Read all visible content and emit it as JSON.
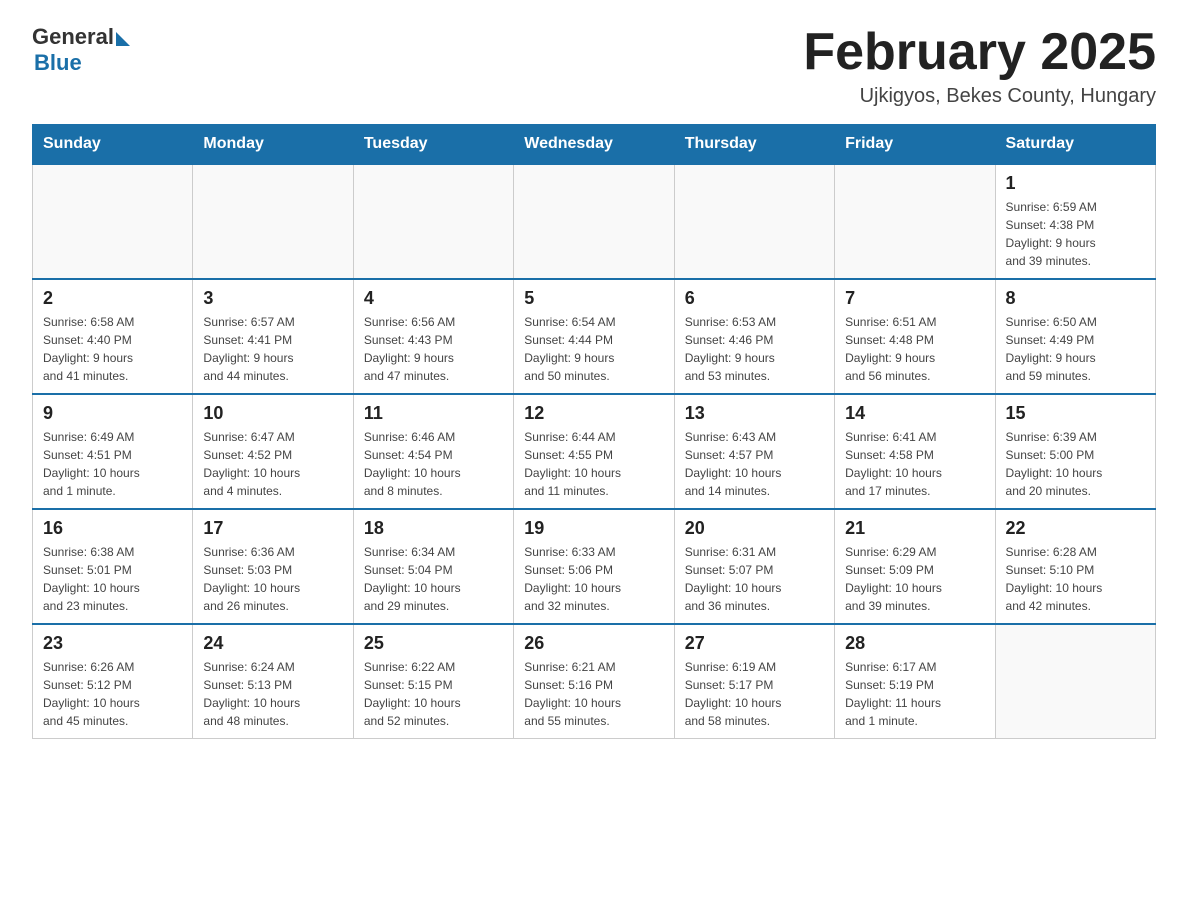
{
  "header": {
    "logo_general": "General",
    "logo_blue": "Blue",
    "month_title": "February 2025",
    "location": "Ujkigyos, Bekes County, Hungary"
  },
  "weekdays": [
    "Sunday",
    "Monday",
    "Tuesday",
    "Wednesday",
    "Thursday",
    "Friday",
    "Saturday"
  ],
  "weeks": [
    [
      {
        "day": "",
        "info": ""
      },
      {
        "day": "",
        "info": ""
      },
      {
        "day": "",
        "info": ""
      },
      {
        "day": "",
        "info": ""
      },
      {
        "day": "",
        "info": ""
      },
      {
        "day": "",
        "info": ""
      },
      {
        "day": "1",
        "info": "Sunrise: 6:59 AM\nSunset: 4:38 PM\nDaylight: 9 hours\nand 39 minutes."
      }
    ],
    [
      {
        "day": "2",
        "info": "Sunrise: 6:58 AM\nSunset: 4:40 PM\nDaylight: 9 hours\nand 41 minutes."
      },
      {
        "day": "3",
        "info": "Sunrise: 6:57 AM\nSunset: 4:41 PM\nDaylight: 9 hours\nand 44 minutes."
      },
      {
        "day": "4",
        "info": "Sunrise: 6:56 AM\nSunset: 4:43 PM\nDaylight: 9 hours\nand 47 minutes."
      },
      {
        "day": "5",
        "info": "Sunrise: 6:54 AM\nSunset: 4:44 PM\nDaylight: 9 hours\nand 50 minutes."
      },
      {
        "day": "6",
        "info": "Sunrise: 6:53 AM\nSunset: 4:46 PM\nDaylight: 9 hours\nand 53 minutes."
      },
      {
        "day": "7",
        "info": "Sunrise: 6:51 AM\nSunset: 4:48 PM\nDaylight: 9 hours\nand 56 minutes."
      },
      {
        "day": "8",
        "info": "Sunrise: 6:50 AM\nSunset: 4:49 PM\nDaylight: 9 hours\nand 59 minutes."
      }
    ],
    [
      {
        "day": "9",
        "info": "Sunrise: 6:49 AM\nSunset: 4:51 PM\nDaylight: 10 hours\nand 1 minute."
      },
      {
        "day": "10",
        "info": "Sunrise: 6:47 AM\nSunset: 4:52 PM\nDaylight: 10 hours\nand 4 minutes."
      },
      {
        "day": "11",
        "info": "Sunrise: 6:46 AM\nSunset: 4:54 PM\nDaylight: 10 hours\nand 8 minutes."
      },
      {
        "day": "12",
        "info": "Sunrise: 6:44 AM\nSunset: 4:55 PM\nDaylight: 10 hours\nand 11 minutes."
      },
      {
        "day": "13",
        "info": "Sunrise: 6:43 AM\nSunset: 4:57 PM\nDaylight: 10 hours\nand 14 minutes."
      },
      {
        "day": "14",
        "info": "Sunrise: 6:41 AM\nSunset: 4:58 PM\nDaylight: 10 hours\nand 17 minutes."
      },
      {
        "day": "15",
        "info": "Sunrise: 6:39 AM\nSunset: 5:00 PM\nDaylight: 10 hours\nand 20 minutes."
      }
    ],
    [
      {
        "day": "16",
        "info": "Sunrise: 6:38 AM\nSunset: 5:01 PM\nDaylight: 10 hours\nand 23 minutes."
      },
      {
        "day": "17",
        "info": "Sunrise: 6:36 AM\nSunset: 5:03 PM\nDaylight: 10 hours\nand 26 minutes."
      },
      {
        "day": "18",
        "info": "Sunrise: 6:34 AM\nSunset: 5:04 PM\nDaylight: 10 hours\nand 29 minutes."
      },
      {
        "day": "19",
        "info": "Sunrise: 6:33 AM\nSunset: 5:06 PM\nDaylight: 10 hours\nand 32 minutes."
      },
      {
        "day": "20",
        "info": "Sunrise: 6:31 AM\nSunset: 5:07 PM\nDaylight: 10 hours\nand 36 minutes."
      },
      {
        "day": "21",
        "info": "Sunrise: 6:29 AM\nSunset: 5:09 PM\nDaylight: 10 hours\nand 39 minutes."
      },
      {
        "day": "22",
        "info": "Sunrise: 6:28 AM\nSunset: 5:10 PM\nDaylight: 10 hours\nand 42 minutes."
      }
    ],
    [
      {
        "day": "23",
        "info": "Sunrise: 6:26 AM\nSunset: 5:12 PM\nDaylight: 10 hours\nand 45 minutes."
      },
      {
        "day": "24",
        "info": "Sunrise: 6:24 AM\nSunset: 5:13 PM\nDaylight: 10 hours\nand 48 minutes."
      },
      {
        "day": "25",
        "info": "Sunrise: 6:22 AM\nSunset: 5:15 PM\nDaylight: 10 hours\nand 52 minutes."
      },
      {
        "day": "26",
        "info": "Sunrise: 6:21 AM\nSunset: 5:16 PM\nDaylight: 10 hours\nand 55 minutes."
      },
      {
        "day": "27",
        "info": "Sunrise: 6:19 AM\nSunset: 5:17 PM\nDaylight: 10 hours\nand 58 minutes."
      },
      {
        "day": "28",
        "info": "Sunrise: 6:17 AM\nSunset: 5:19 PM\nDaylight: 11 hours\nand 1 minute."
      },
      {
        "day": "",
        "info": ""
      }
    ]
  ]
}
